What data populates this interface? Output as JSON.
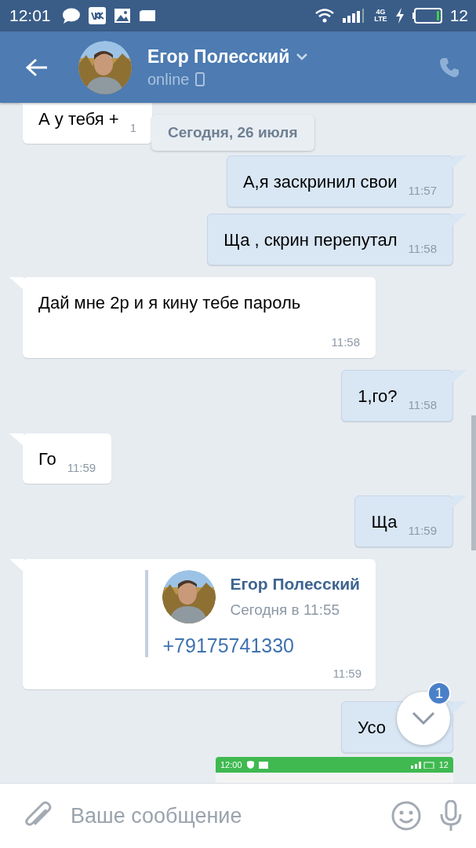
{
  "status_bar": {
    "time": "12:01",
    "network": "4G",
    "network_sub": "LTE",
    "battery": "12"
  },
  "header": {
    "name": "Егор Полесский",
    "presence": "online"
  },
  "date_divider": "Сегодня, 26 июля",
  "messages": [
    {
      "kind": "text",
      "outgoing": false,
      "text": "А у тебя +",
      "time": "1"
    },
    {
      "kind": "text",
      "outgoing": true,
      "text": "А,я заскринил свои",
      "time": "11:57"
    },
    {
      "kind": "text",
      "outgoing": true,
      "text": "Ща , скрин перепутал",
      "time": "11:58"
    },
    {
      "kind": "text",
      "outgoing": false,
      "text": "Дай мне 2р и я кину тебе пароль",
      "time": "11:58"
    },
    {
      "kind": "text",
      "outgoing": true,
      "text": "1,го?",
      "time": "11:58"
    },
    {
      "kind": "text",
      "outgoing": false,
      "text": "Го",
      "time": "11:59"
    },
    {
      "kind": "text",
      "outgoing": true,
      "text": "Ща",
      "time": "11:59"
    },
    {
      "kind": "forward",
      "outgoing": false,
      "author": "Егор Полесский",
      "date": "Сегодня в 11:55",
      "text": "+79175741330",
      "time": "11:59"
    },
    {
      "kind": "text",
      "outgoing": true,
      "text": "Усо"
    },
    {
      "kind": "screenshot",
      "outgoing": true,
      "clock": "12:00",
      "battery": "12"
    }
  ],
  "scroll_button": {
    "badge": "1"
  },
  "composer": {
    "placeholder": "Ваше сообщение"
  }
}
